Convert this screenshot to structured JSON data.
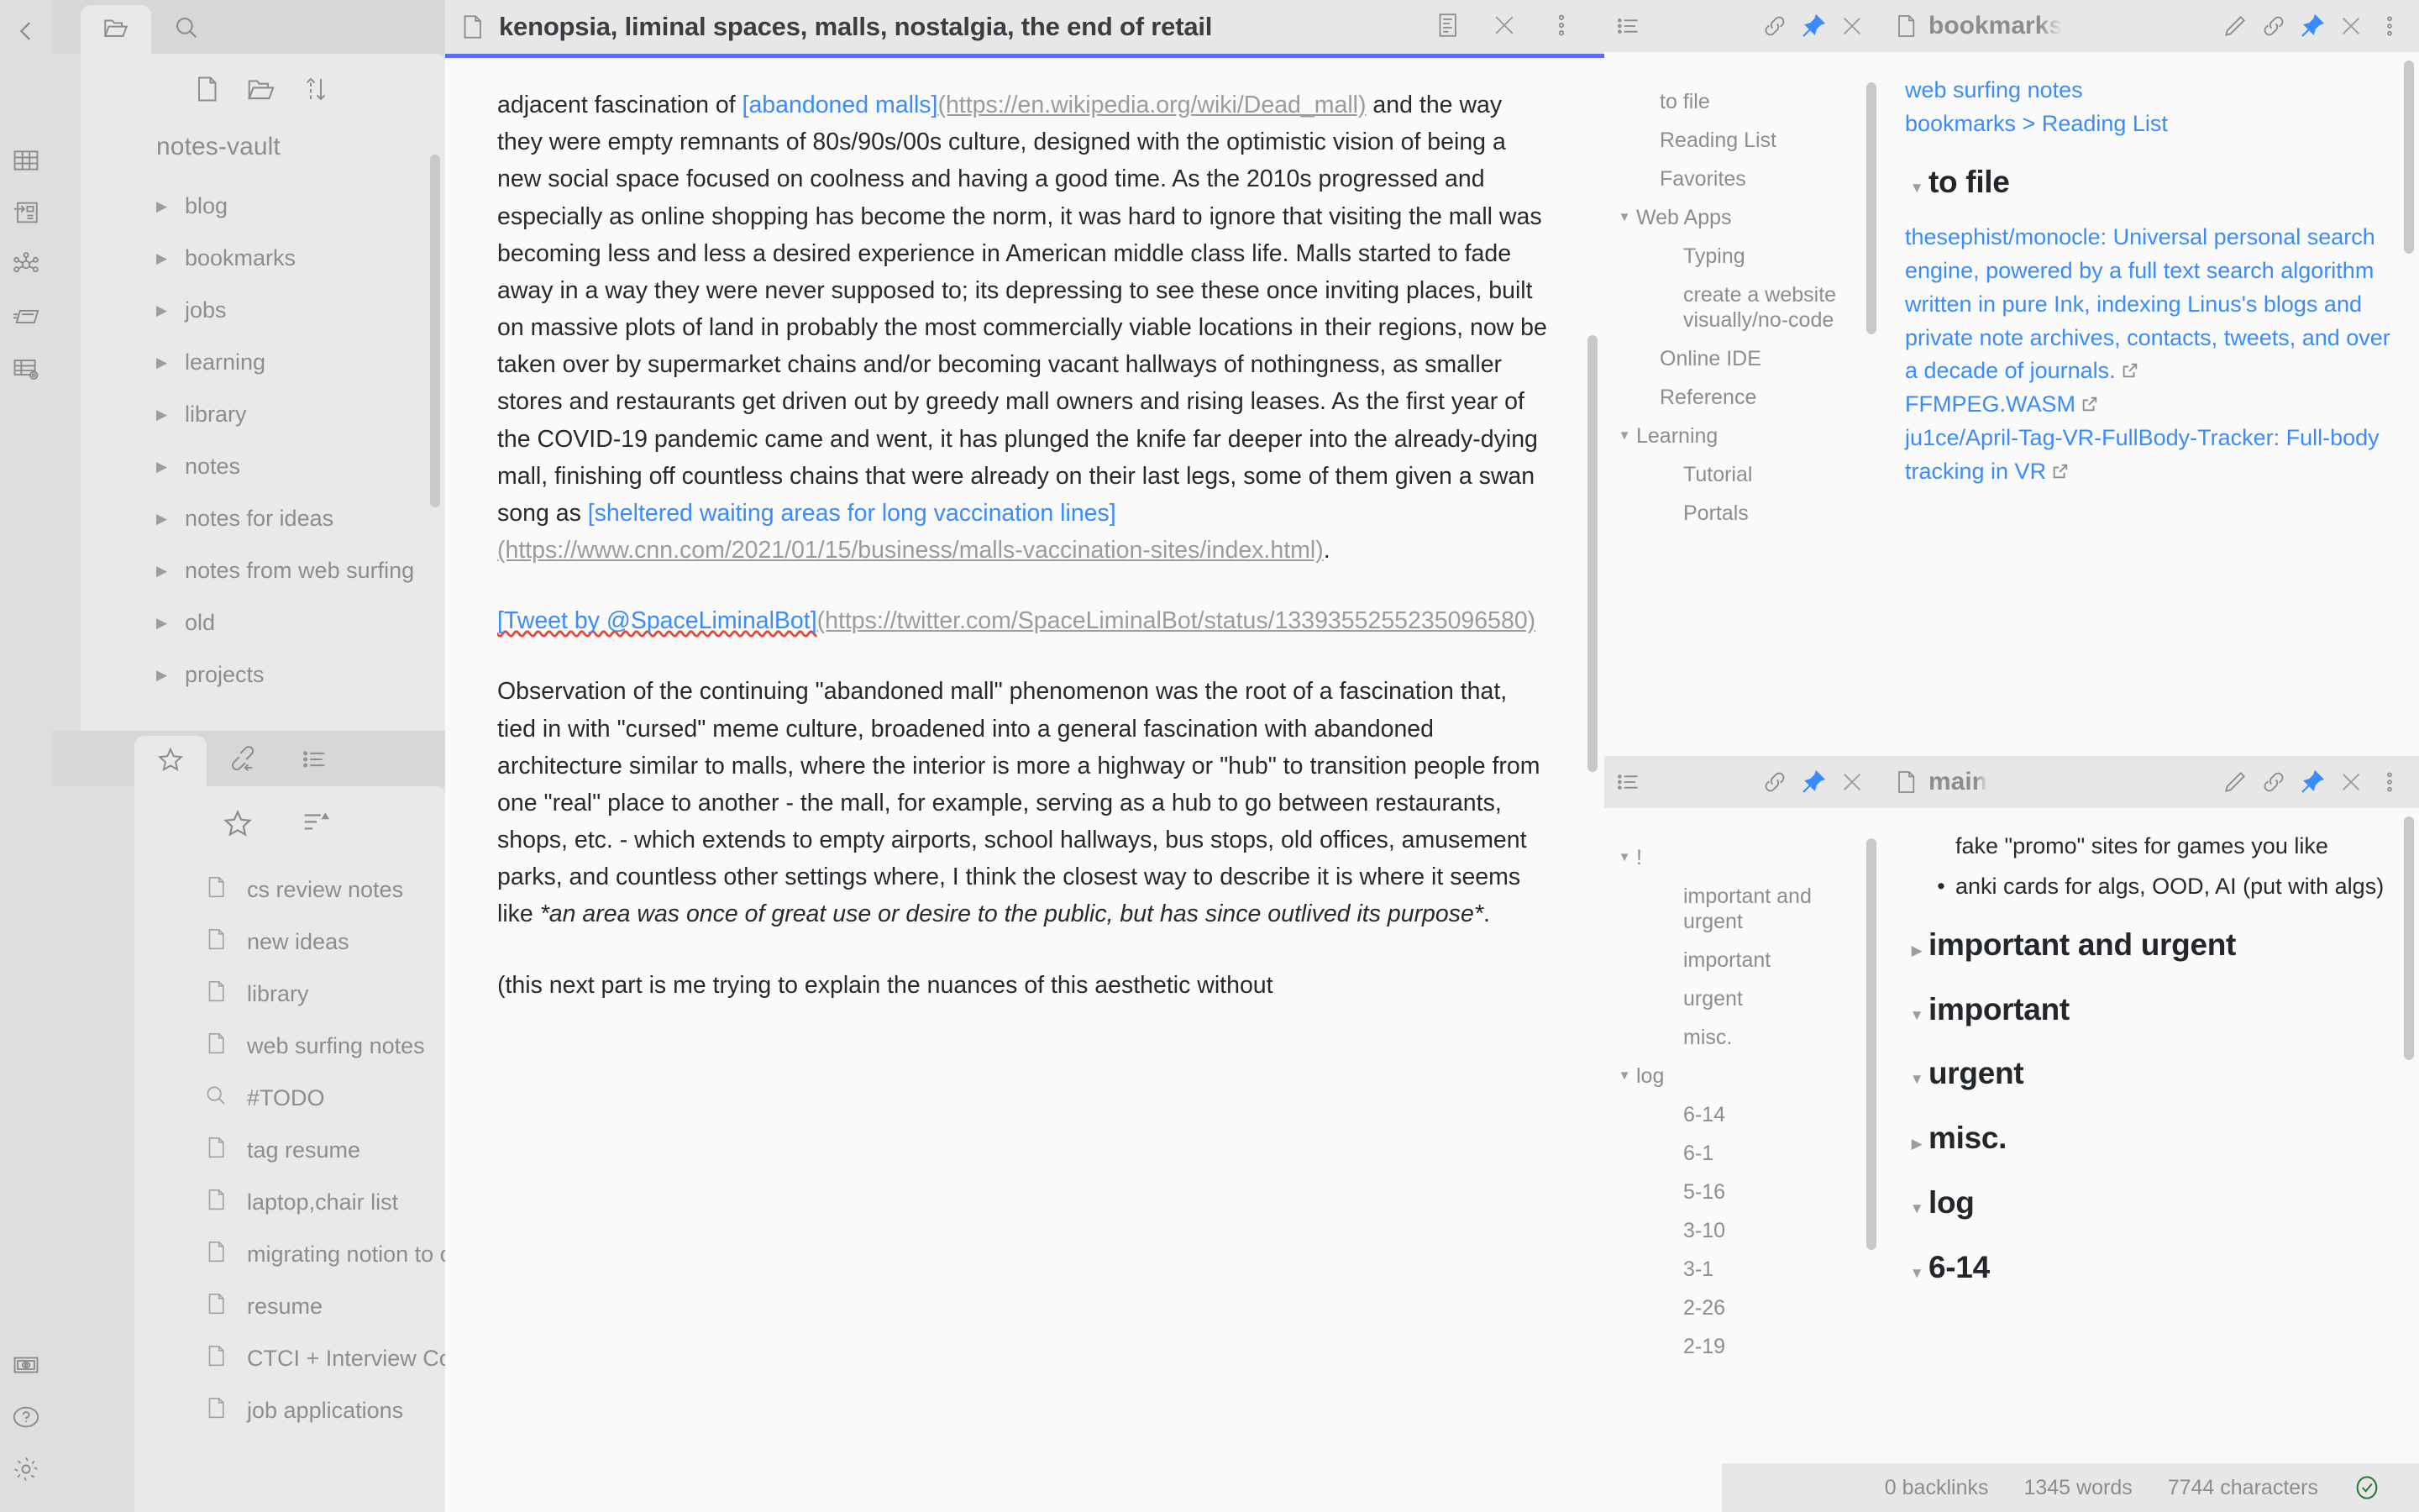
{
  "rail": {
    "icons": [
      {
        "name": "table-icon"
      },
      {
        "name": "outline-panel-icon"
      },
      {
        "name": "graph-view-icon"
      },
      {
        "name": "card-stack-icon"
      },
      {
        "name": "table-settings-icon"
      }
    ],
    "bottom_icons": [
      {
        "name": "screenshot-icon"
      },
      {
        "name": "help-icon"
      },
      {
        "name": "settings-gear-icon"
      }
    ],
    "collapse_icon": "collapse-left-icon"
  },
  "sidebar": {
    "tabs": [
      {
        "name": "files-tab",
        "icon": "folder-icon",
        "active": true
      },
      {
        "name": "search-tab",
        "icon": "search-icon",
        "active": false
      }
    ],
    "toolbar": [
      {
        "name": "new-file-button",
        "icon": "file-icon"
      },
      {
        "name": "new-folder-button",
        "icon": "folder-icon"
      },
      {
        "name": "sort-button",
        "icon": "sort-updown-icon"
      }
    ],
    "vault_name": "notes-vault",
    "tree": [
      {
        "label": "blog",
        "collapsed": true
      },
      {
        "label": "bookmarks",
        "collapsed": true
      },
      {
        "label": "jobs",
        "collapsed": true
      },
      {
        "label": "learning",
        "collapsed": true
      },
      {
        "label": "library",
        "collapsed": true
      },
      {
        "label": "notes",
        "collapsed": true
      },
      {
        "label": "notes for ideas",
        "collapsed": true
      },
      {
        "label": "notes from web surfing",
        "collapsed": true
      },
      {
        "label": "old",
        "collapsed": true
      },
      {
        "label": "projects",
        "collapsed": true
      }
    ],
    "tabs2": [
      {
        "name": "starred-tab",
        "icon": "star-icon",
        "active": true
      },
      {
        "name": "backlinks-tab",
        "icon": "link-back-icon",
        "active": false
      },
      {
        "name": "outline-tab",
        "icon": "list-icon",
        "active": false
      }
    ],
    "toolbar2": [
      {
        "name": "add-star-button",
        "icon": "star-icon"
      },
      {
        "name": "sort-starred-button",
        "icon": "list-sort-icon"
      }
    ],
    "starred": [
      {
        "label": "cs review notes",
        "icon": "file-icon"
      },
      {
        "label": "new ideas",
        "icon": "file-icon"
      },
      {
        "label": "library",
        "icon": "file-icon"
      },
      {
        "label": "web surfing notes",
        "icon": "file-icon"
      },
      {
        "label": "#TODO",
        "icon": "search-icon"
      },
      {
        "label": "tag resume",
        "icon": "file-icon"
      },
      {
        "label": "laptop,chair list",
        "icon": "file-icon"
      },
      {
        "label": "migrating notion to o...",
        "icon": "file-icon"
      },
      {
        "label": "resume",
        "icon": "file-icon"
      },
      {
        "label": "CTCI + Interview Co...",
        "icon": "file-icon"
      },
      {
        "label": "job applications",
        "icon": "file-icon"
      }
    ]
  },
  "editor": {
    "doc_icon": "file-icon",
    "title": "kenopsia, liminal spaces, malls, nostalgia, the end of retail",
    "actions": [
      {
        "name": "reading-view-button",
        "icon": "reading-view-icon"
      },
      {
        "name": "close-tab-button",
        "icon": "close-icon"
      },
      {
        "name": "more-options-button",
        "icon": "more-vertical-icon"
      }
    ],
    "content": {
      "p1_pre": "adjacent fascination of ",
      "p1_link": "[abandoned malls]",
      "p1_url": "(https://en.wikipedia.org/wiki/Dead_mall)",
      "p1_post": " and the way they were empty remnants of 80s/90s/00s culture, designed with the optimistic vision of being a new social space focused on coolness and having a good time. As the 2010s progressed and especially as online shopping has become the norm, it was hard to ignore that visiting the mall was becoming less and less a desired experience in American middle class life. Malls started to fade away in a way they were never supposed to; its depressing to see these once inviting places, built on massive plots of land in probably the most commercially viable locations in their regions, now be taken over by supermarket chains and/or becoming vacant hallways of nothingness, as smaller stores and restaurants get driven out by greedy mall owners and rising leases. As the first year of the COVID-19 pandemic came and went, it has plunged the knife far deeper into the already-dying mall, finishing off countless chains that were already on their last legs, some of them given a swan song as ",
      "p1_link2": "[sheltered waiting areas for long vaccination lines]",
      "p1_url2": "(https://www.cnn.com/2021/01/15/business/malls-vaccination-sites/index.html)",
      "p1_end": ".",
      "p2_link": "[Tweet by @SpaceLiminalBot]",
      "p2_url": "(https://twitter.com/SpaceLiminalBot/status/1339355255235096580)",
      "p3_a": "Observation of the continuing \"abandoned mall\" phenomenon was the root of a fascination that, tied in with \"cursed\" meme culture, broadened into a general fascination with abandoned architecture similar to malls, where the interior is more a highway or \"hub\" to transition people from one \"real\" place to another - the mall, for example, serving as a hub to go between restaurants, shops, etc. - which extends to empty airports, school hallways, bus stops, old offices, amusement parks, and countless other settings where, I think the closest way to describe it is where it seems like ",
      "p3_em": "*an area was once of great use or desire to the public, but has since outlived its purpose*",
      "p3_b": ".",
      "p4": "(this next part is me trying to explain the nuances of this aesthetic without"
    }
  },
  "outline_top": {
    "header_icons": [
      {
        "name": "outline-icon"
      },
      {
        "name": "link-icon"
      },
      {
        "name": "pin-icon"
      },
      {
        "name": "close-icon"
      }
    ],
    "items": [
      {
        "label": "to file",
        "level": 1,
        "tri": ""
      },
      {
        "label": "Reading List",
        "level": 1,
        "tri": ""
      },
      {
        "label": "Favorites",
        "level": 1,
        "tri": ""
      },
      {
        "label": "Web Apps",
        "level": 0,
        "tri": "▼"
      },
      {
        "label": "Typing",
        "level": 2,
        "tri": ""
      },
      {
        "label": "create a website visually/no-code",
        "level": 2,
        "tri": ""
      },
      {
        "label": "Online IDE",
        "level": 1,
        "tri": ""
      },
      {
        "label": "Reference",
        "level": 1,
        "tri": ""
      },
      {
        "label": "Learning",
        "level": 0,
        "tri": "▼"
      },
      {
        "label": "Tutorial",
        "level": 2,
        "tri": ""
      },
      {
        "label": "Portals",
        "level": 2,
        "tri": ""
      }
    ]
  },
  "bookmarks_pane": {
    "doc_icon": "file-icon",
    "title": "bookmarks",
    "actions": [
      {
        "name": "edit-button",
        "icon": "pencil-icon"
      },
      {
        "name": "link-button",
        "icon": "link-icon"
      },
      {
        "name": "pin-button",
        "icon": "pin-icon"
      },
      {
        "name": "close-button",
        "icon": "close-icon"
      },
      {
        "name": "more-button",
        "icon": "more-vertical-icon"
      }
    ],
    "breadcrumb1": "web surfing notes",
    "breadcrumb2": "bookmarks > Reading List",
    "heading": "to file",
    "links": [
      "thesephist/monocle: Universal personal search engine, powered by a full text search algorithm written in pure Ink, indexing Linus's blogs and private note archives, contacts, tweets, and over a decade of journals.",
      "FFMPEG.WASM",
      "ju1ce/April-Tag-VR-FullBody-Tracker: Full-body tracking in VR"
    ]
  },
  "outline_bottom": {
    "header_icons": [
      {
        "name": "outline-icon"
      },
      {
        "name": "link-icon"
      },
      {
        "name": "pin-icon"
      },
      {
        "name": "close-icon"
      }
    ],
    "items": [
      {
        "label": "!",
        "level": 0,
        "tri": "▼"
      },
      {
        "label": "important and urgent",
        "level": 2,
        "tri": ""
      },
      {
        "label": "important",
        "level": 2,
        "tri": ""
      },
      {
        "label": "urgent",
        "level": 2,
        "tri": ""
      },
      {
        "label": "misc.",
        "level": 2,
        "tri": ""
      },
      {
        "label": "log",
        "level": 0,
        "tri": "▼"
      },
      {
        "label": "6-14",
        "level": 2,
        "tri": ""
      },
      {
        "label": "6-1",
        "level": 2,
        "tri": ""
      },
      {
        "label": "5-16",
        "level": 2,
        "tri": ""
      },
      {
        "label": "3-10",
        "level": 2,
        "tri": ""
      },
      {
        "label": "3-1",
        "level": 2,
        "tri": ""
      },
      {
        "label": "2-26",
        "level": 2,
        "tri": ""
      },
      {
        "label": "2-19",
        "level": 2,
        "tri": ""
      }
    ]
  },
  "main_pane": {
    "doc_icon": "file-icon",
    "title": "main",
    "actions": [
      {
        "name": "edit-button",
        "icon": "pencil-icon"
      },
      {
        "name": "link-button",
        "icon": "link-icon"
      },
      {
        "name": "pin-button",
        "icon": "pin-icon"
      },
      {
        "name": "close-button",
        "icon": "close-icon"
      },
      {
        "name": "more-button",
        "icon": "more-vertical-icon"
      }
    ],
    "partial_text": "fake \"promo\" sites for games you like",
    "bullet": "anki cards for algs, OOD, AI (put with algs)",
    "headings": [
      {
        "label": "important and urgent",
        "tri": "▶"
      },
      {
        "label": "important",
        "tri": "▼"
      },
      {
        "label": "urgent",
        "tri": "▼"
      },
      {
        "label": "misc.",
        "tri": "▶"
      },
      {
        "label": "log",
        "tri": "▼"
      },
      {
        "label": "6-14",
        "tri": "▼"
      }
    ]
  },
  "statusbar": {
    "backlinks": "0 backlinks",
    "words": "1345 words",
    "characters": "7744 characters",
    "sync_icon": "sync-ok-icon"
  },
  "colors": {
    "accent_blue": "#3a8bfd",
    "active_tab_underline": "#5a6df0",
    "sync_green": "#1f7a32"
  }
}
